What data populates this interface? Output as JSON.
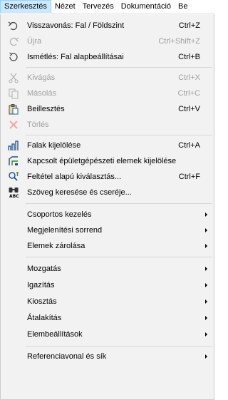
{
  "menubar": {
    "items": [
      "Szerkesztés",
      "Nézet",
      "Tervezés",
      "Dokumentáció",
      "Be"
    ]
  },
  "menu": {
    "items": [
      {
        "label": "Visszavonás: Fal / Földszint",
        "shortcut": "Ctrl+Z",
        "icon": "undo-icon"
      },
      {
        "label": "Újra",
        "shortcut": "Ctrl+Shift+Z",
        "icon": "redo-icon"
      },
      {
        "label": "Ismétlés: Fal alapbeállításai",
        "shortcut": "Ctrl+B",
        "icon": "repeat-icon"
      },
      {
        "label": "Kivágás",
        "shortcut": "Ctrl+X",
        "icon": "cut-icon"
      },
      {
        "label": "Másolás",
        "shortcut": "Ctrl+C",
        "icon": "copy-icon"
      },
      {
        "label": "Beillesztés",
        "shortcut": "Ctrl+V",
        "icon": "paste-icon"
      },
      {
        "label": "Törlés",
        "shortcut": "",
        "icon": "delete-icon"
      },
      {
        "label": "Falak kijelölése",
        "shortcut": "Ctrl+A",
        "icon": "select-walls-icon"
      },
      {
        "label": "Kapcsolt épületgépészeti elemek kijelölése",
        "shortcut": "",
        "icon": "select-mep-icon"
      },
      {
        "label": "Feltétel alapú kiválasztás...",
        "shortcut": "Ctrl+F",
        "icon": "find-select-icon"
      },
      {
        "label": "Szöveg keresése és cseréje...",
        "shortcut": "",
        "icon": "find-replace-icon"
      },
      {
        "label": "Csoportos kezelés",
        "shortcut": "",
        "icon": ""
      },
      {
        "label": "Megjelenítési sorrend",
        "shortcut": "",
        "icon": ""
      },
      {
        "label": "Elemek zárolása",
        "shortcut": "",
        "icon": ""
      },
      {
        "label": "Mozgatás",
        "shortcut": "",
        "icon": ""
      },
      {
        "label": "Igazítás",
        "shortcut": "",
        "icon": ""
      },
      {
        "label": "Kiosztás",
        "shortcut": "",
        "icon": ""
      },
      {
        "label": "Átalakítás",
        "shortcut": "",
        "icon": ""
      },
      {
        "label": "Elembeállítások",
        "shortcut": "",
        "icon": ""
      },
      {
        "label": "Referenciavonal és sík",
        "shortcut": "",
        "icon": ""
      }
    ]
  },
  "colors": {
    "menu_background": "#f2f2f2",
    "disabled_text": "#a0a0a0",
    "active_menubar_highlight": "#cce8ff"
  }
}
